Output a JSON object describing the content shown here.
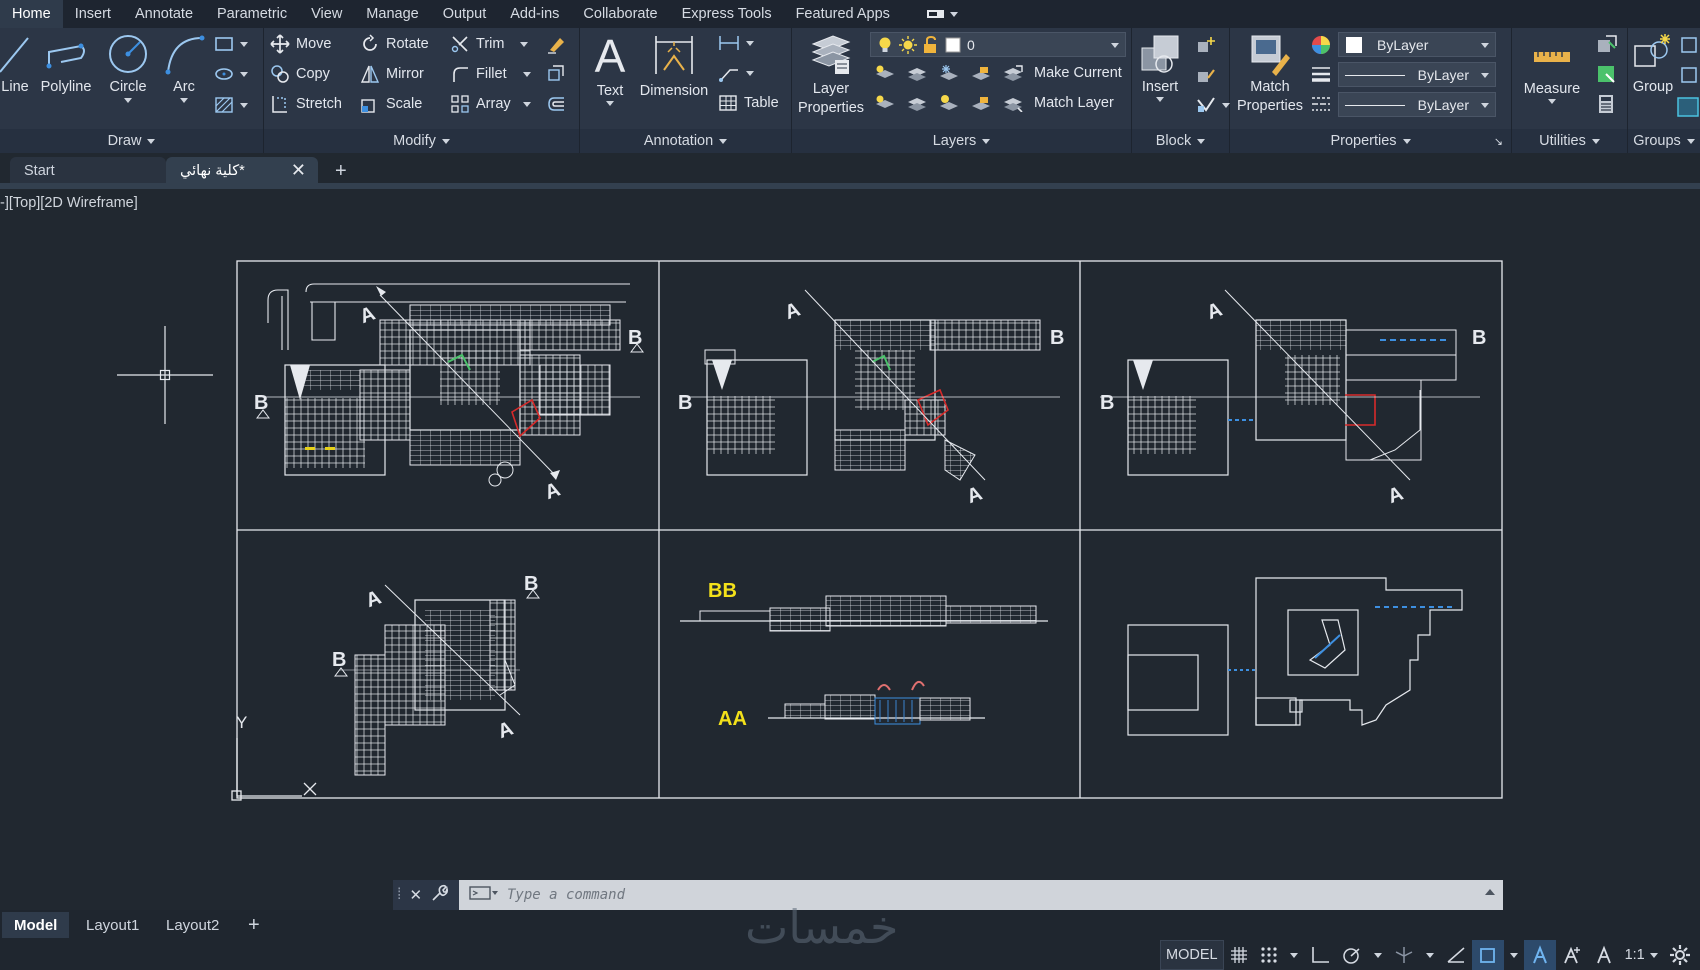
{
  "ribbon_tabs": [
    "Home",
    "Insert",
    "Annotate",
    "Parametric",
    "View",
    "Manage",
    "Output",
    "Add-ins",
    "Collaborate",
    "Express Tools",
    "Featured Apps"
  ],
  "active_tab": "Home",
  "panels": {
    "draw": {
      "title": "Draw",
      "line": "Line",
      "polyline": "Polyline",
      "circle": "Circle",
      "arc": "Arc"
    },
    "modify": {
      "title": "Modify",
      "move": "Move",
      "rotate": "Rotate",
      "trim": "Trim",
      "copy": "Copy",
      "mirror": "Mirror",
      "fillet": "Fillet",
      "stretch": "Stretch",
      "scale": "Scale",
      "array": "Array"
    },
    "annotation": {
      "title": "Annotation",
      "text": "Text",
      "dimension": "Dimension",
      "table": "Table"
    },
    "layers": {
      "title": "Layers",
      "layer_properties_1": "Layer",
      "layer_properties_2": "Properties",
      "current_layer": "0",
      "make_current": "Make Current",
      "match_layer": "Match Layer"
    },
    "block": {
      "title": "Block",
      "insert": "Insert"
    },
    "properties": {
      "title": "Properties",
      "match_1": "Match",
      "match_2": "Properties",
      "color": "ByLayer",
      "linetype": "ByLayer",
      "lineweight": "ByLayer"
    },
    "utilities": {
      "title": "Utilities",
      "measure": "Measure"
    },
    "groups": {
      "title": "Groups",
      "group": "Group"
    }
  },
  "file_tabs": [
    "Start",
    "كلية نهائي*"
  ],
  "viewport_label": "-][Top][2D Wireframe]",
  "section_labels": {
    "bb": "BB",
    "aa": "AA"
  },
  "plan_markers": {
    "a": "A",
    "b": "B"
  },
  "axis": {
    "y": "Y"
  },
  "command_placeholder": "Type a command",
  "layout_tabs": [
    "Model",
    "Layout1",
    "Layout2"
  ],
  "status": {
    "model": "MODEL",
    "scale": "1:1"
  },
  "watermark": "خمسات",
  "colors": {
    "accent_blue": "#3d8fe0",
    "yellow": "#f3e11a",
    "canvas": "#212830"
  }
}
